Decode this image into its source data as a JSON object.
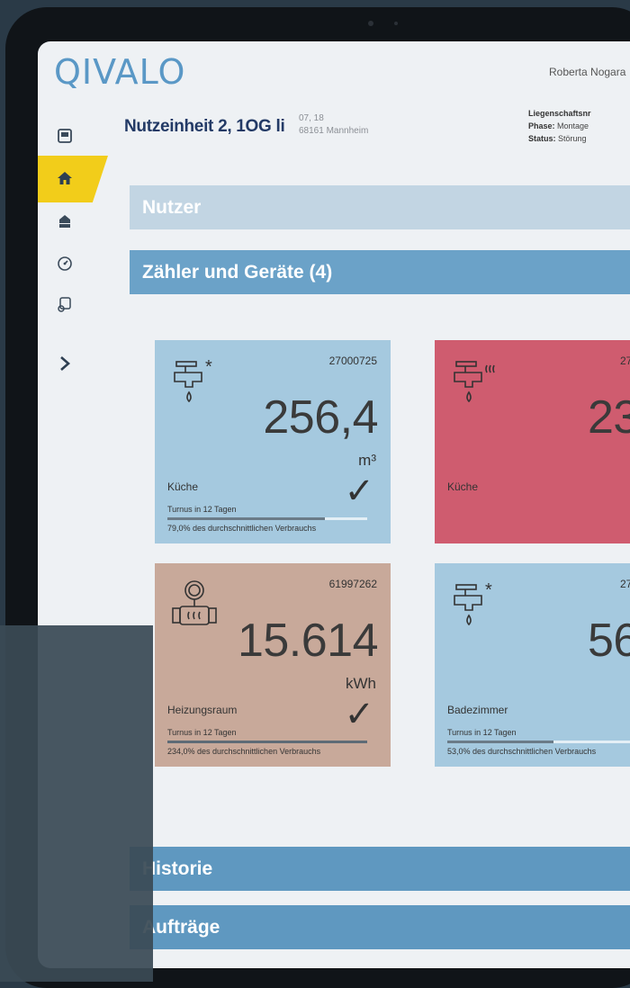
{
  "app": {
    "logo": "QIVALO",
    "user_name": "Roberta Nogara"
  },
  "header": {
    "unit_title": "Nutzeinheit 2, 1OG li",
    "address_line1": "07, 18",
    "address_line2": "68161  Mannheim",
    "meta_liegenschaft_label": "Liegenschaftsnr",
    "meta_phase_label": "Phase:",
    "meta_phase_value": "Montage",
    "meta_status_label": "Status:",
    "meta_status_value": "Störung"
  },
  "sidebar": {
    "items": [
      "meter-icon",
      "home-icon",
      "hand-house-icon",
      "gauge-icon",
      "contract-icon",
      "chevron-right-icon"
    ],
    "active": "home-icon",
    "accent": "#f2cd1a"
  },
  "sections": {
    "nutzer": "Nutzer",
    "zaehler": "Zähler und Geräte (4)",
    "historie": "Historie",
    "auftraege": "Aufträge"
  },
  "cards": [
    {
      "serial": "27000725",
      "value": "256,4",
      "unit": "m³",
      "room": "Küche",
      "turnus": "Turnus in 12 Tagen",
      "pct_text": "79,0% des durchschnittlichen Verbrauchs",
      "progress": 0.79,
      "icon": "cold-water-tap-icon",
      "status": "ok",
      "color": "#a5c9df"
    },
    {
      "serial": "27",
      "value": "23",
      "unit": "",
      "room": "Küche",
      "turnus": "",
      "pct_text": "",
      "progress": 0,
      "icon": "warm-water-tap-icon",
      "status": "error",
      "color": "#cf5c6f"
    },
    {
      "serial": "61997262",
      "value": "15.614",
      "unit": "kWh",
      "room": "Heizungsraum",
      "turnus": "Turnus in 12 Tagen",
      "pct_text": "234,0% des durchschnittlichen Verbrauchs",
      "progress": 1.0,
      "icon": "heat-meter-icon",
      "status": "ok",
      "color": "#c8a99a"
    },
    {
      "serial": "27",
      "value": "56",
      "unit": "",
      "room": "Badezimmer",
      "turnus": "Turnus in 12 Tagen",
      "pct_text": "53,0% des durchschnittlichen Verbrauchs",
      "progress": 0.53,
      "icon": "cold-water-tap-icon",
      "status": "ok",
      "color": "#a5c9df"
    }
  ]
}
